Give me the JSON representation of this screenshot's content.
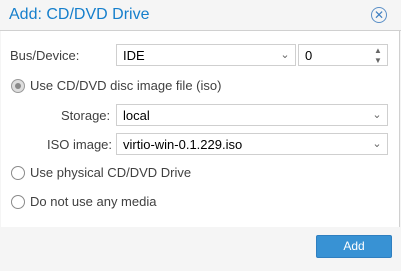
{
  "dialog": {
    "title": "Add: CD/DVD Drive"
  },
  "bus_device": {
    "label": "Bus/Device:",
    "bus_value": "IDE",
    "device_value": "0"
  },
  "options": {
    "iso_label": "Use CD/DVD disc image file (iso)",
    "physical_label": "Use physical CD/DVD Drive",
    "none_label": "Do not use any media",
    "selected": "iso"
  },
  "storage": {
    "label": "Storage:",
    "value": "local"
  },
  "iso_image": {
    "label": "ISO image:",
    "value": "virtio-win-0.1.229.iso"
  },
  "footer": {
    "add_label": "Add"
  }
}
